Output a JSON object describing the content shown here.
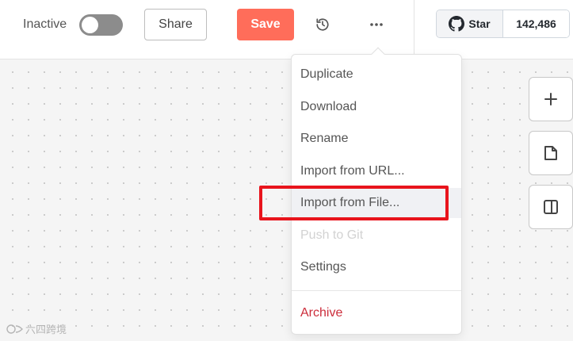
{
  "header": {
    "toggle_label": "Inactive",
    "share_label": "Share",
    "save_label": "Save",
    "github": {
      "star_label": "Star",
      "star_count": "142,486"
    }
  },
  "menu": {
    "items": [
      {
        "label": "Duplicate"
      },
      {
        "label": "Download"
      },
      {
        "label": "Rename"
      },
      {
        "label": "Import from URL..."
      },
      {
        "label": "Import from File..."
      },
      {
        "label": "Push to Git"
      },
      {
        "label": "Settings"
      },
      {
        "label": "Archive"
      }
    ]
  },
  "watermark": {
    "text": "六四跨境"
  },
  "colors": {
    "save_button": "#ff6d5a",
    "archive_text": "#cc2d3b",
    "highlight_border": "#e8141c",
    "toggle_off": "#8c8c8c"
  },
  "icons": {
    "history": "history-icon",
    "more": "more-horizontal-icon",
    "github": "github-icon",
    "add": "plus-icon",
    "sticky_note": "sticky-note-icon",
    "panel": "panel-icon"
  }
}
